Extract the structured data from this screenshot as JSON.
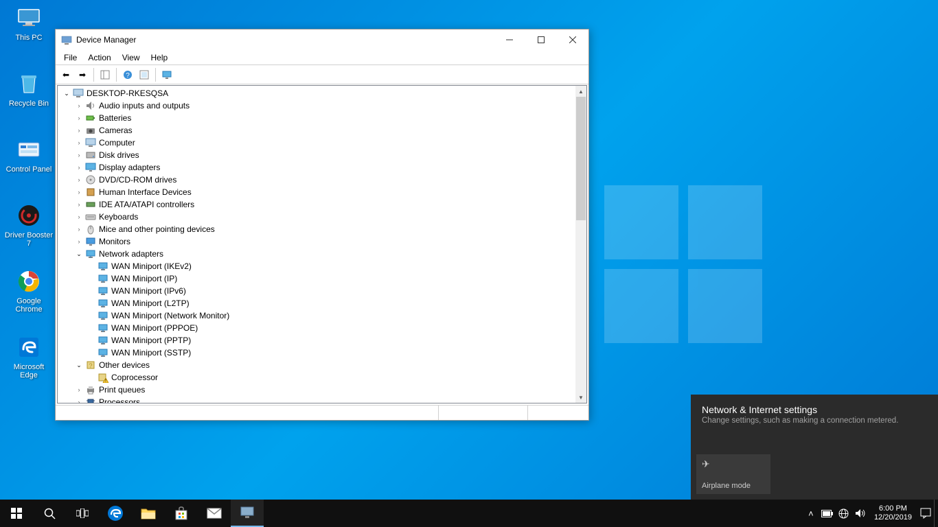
{
  "desktop_icons": {
    "this_pc": "This PC",
    "recycle_bin": "Recycle Bin",
    "control_panel": "Control Panel",
    "driver_booster": "Driver Booster 7",
    "google_chrome": "Google Chrome",
    "microsoft_edge": "Microsoft Edge"
  },
  "window": {
    "title": "Device Manager",
    "menus": {
      "file": "File",
      "action": "Action",
      "view": "View",
      "help": "Help"
    },
    "tree": {
      "root": "DESKTOP-RKESQSA",
      "categories": [
        "Audio inputs and outputs",
        "Batteries",
        "Cameras",
        "Computer",
        "Disk drives",
        "Display adapters",
        "DVD/CD-ROM drives",
        "Human Interface Devices",
        "IDE ATA/ATAPI controllers",
        "Keyboards",
        "Mice and other pointing devices",
        "Monitors"
      ],
      "network_adapters_label": "Network adapters",
      "network_adapters": [
        "WAN Miniport (IKEv2)",
        "WAN Miniport (IP)",
        "WAN Miniport (IPv6)",
        "WAN Miniport (L2TP)",
        "WAN Miniport (Network Monitor)",
        "WAN Miniport (PPPOE)",
        "WAN Miniport (PPTP)",
        "WAN Miniport (SSTP)"
      ],
      "other_devices_label": "Other devices",
      "other_devices": [
        "Coprocessor"
      ],
      "print_queues": "Print queues",
      "processors": "Processors"
    }
  },
  "network_panel": {
    "title": "Network & Internet settings",
    "subtitle": "Change settings, such as making a connection metered.",
    "airplane_tile": "Airplane mode"
  },
  "clock": {
    "time": "6:00 PM",
    "date": "12/20/2019"
  }
}
